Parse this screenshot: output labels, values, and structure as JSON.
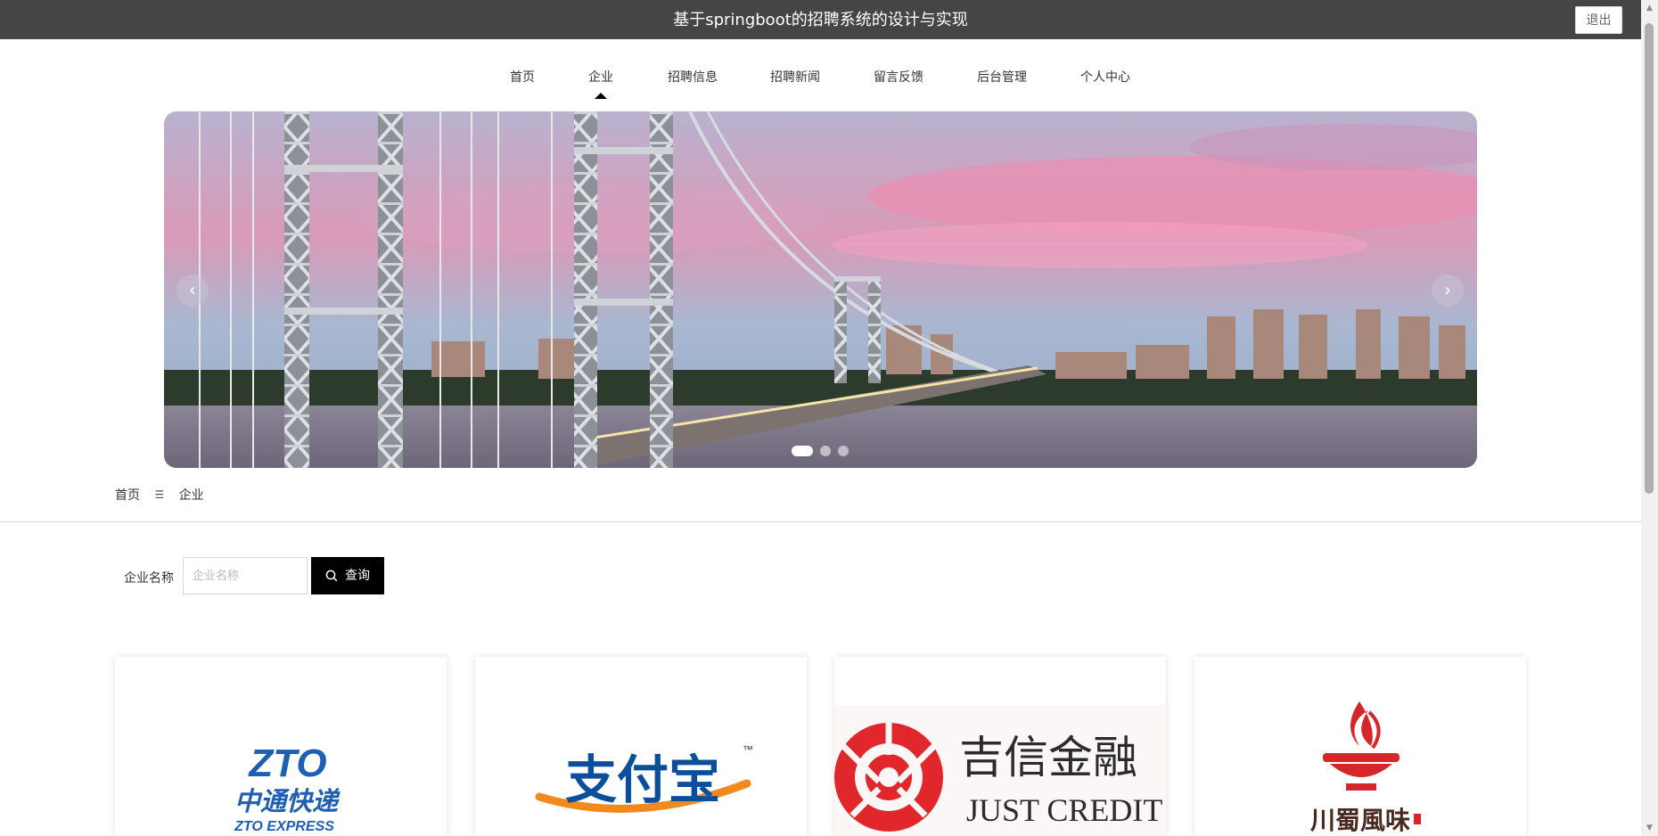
{
  "header": {
    "title": "基于springboot的招聘系统的设计与实现",
    "logout_label": "退出"
  },
  "nav": {
    "items": [
      "首页",
      "企业",
      "招聘信息",
      "招聘新闻",
      "留言反馈",
      "后台管理",
      "个人中心"
    ],
    "active_index": 1
  },
  "carousel": {
    "prev_label": "‹",
    "next_label": "›",
    "slide_count": 3,
    "active_slide": 0
  },
  "breadcrumb": {
    "home": "首页",
    "separator": "☰",
    "current": "企业"
  },
  "search": {
    "label": "企业名称",
    "placeholder": "企业名称",
    "value": "",
    "button_label": "查询"
  },
  "companies": [
    {
      "logo_main": "ZTO",
      "logo_cn": "中通快递",
      "logo_en": "ZTO EXPRESS"
    },
    {
      "logo_main": "支付宝",
      "logo_tm": "™"
    },
    {
      "logo_cn": "吉信金融",
      "logo_en": "JUST CREDIT"
    },
    {
      "logo_cn": "川蜀風味"
    }
  ],
  "colors": {
    "header_bg": "#454545",
    "button_bg": "#000000",
    "zto_blue": "#1d5fb3",
    "alipay_blue": "#0b4f9c",
    "alipay_orange": "#f08a1c",
    "just_red": "#e1262c",
    "chuan_red": "#d6262a"
  }
}
